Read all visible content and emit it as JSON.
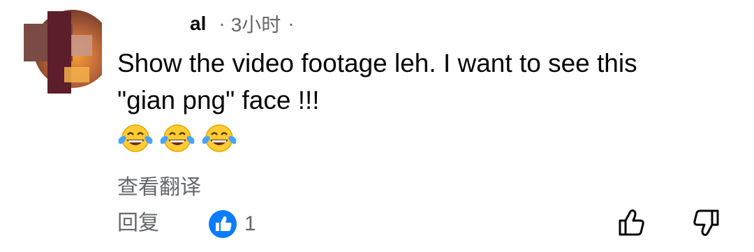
{
  "comment": {
    "author": "al",
    "separator": "·",
    "time": "3小时",
    "trailing_separator": "·",
    "text_line1": "Show the video footage leh. I want to see this",
    "text_line2": "\"gian png\" face !!!",
    "emojis": [
      "face-with-tears-of-joy",
      "face-with-tears-of-joy",
      "face-with-tears-of-joy"
    ],
    "translate_label": "查看翻译",
    "reply_label": "回复",
    "reaction_count": "1"
  },
  "colors": {
    "text": "#050505",
    "secondary": "#65676b",
    "like_blue": "#0a7cff",
    "emoji_yellow": "#ffcc33",
    "tear_blue": "#4aa3ff"
  }
}
